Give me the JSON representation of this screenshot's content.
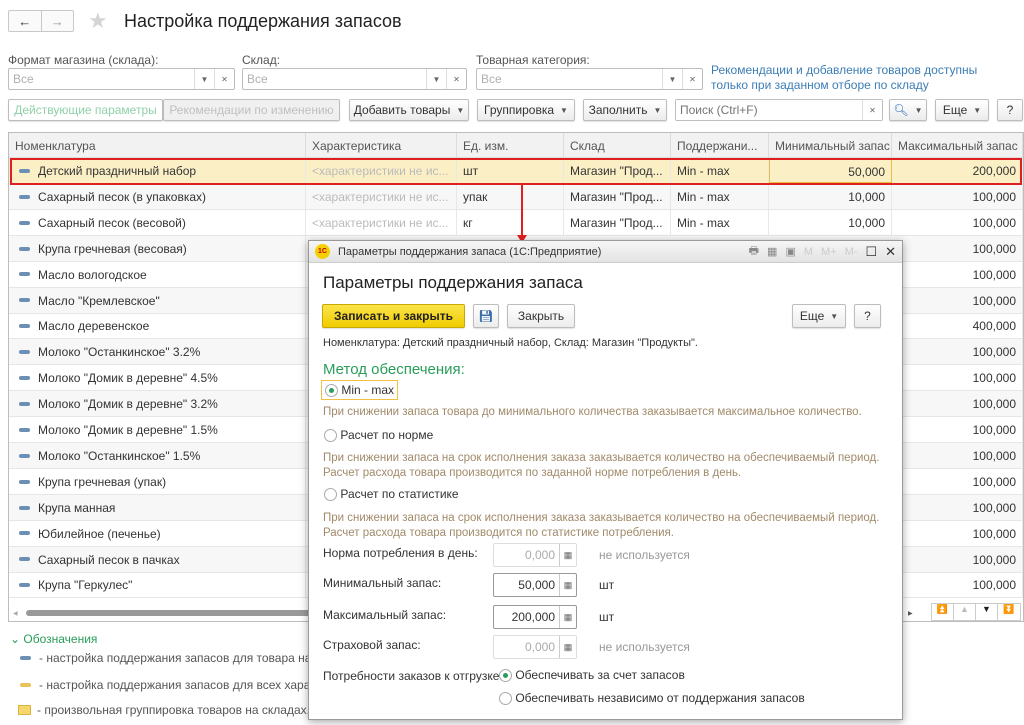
{
  "header": {
    "title": "Настройка поддержания запасов",
    "back_icon": "←",
    "forward_icon": "→"
  },
  "filters": {
    "format_label": "Формат магазина (склада):",
    "format_value": "Все",
    "warehouse_label": "Склад:",
    "warehouse_value": "Все",
    "category_label": "Товарная категория:",
    "category_value": "Все",
    "note": "Рекомендации и добавление товаров доступны только при заданном отборе по складу"
  },
  "toolbar": {
    "tab_current": "Действующие параметры",
    "tab_recommend": "Рекомендации по изменению",
    "add_goods": "Добавить товары",
    "grouping": "Группировка",
    "fill": "Заполнить",
    "search_placeholder": "Поиск (Ctrl+F)",
    "more": "Еще",
    "help": "?"
  },
  "table": {
    "columns": [
      "Номенклатура",
      "Характеристика",
      "Ед. изм.",
      "Склад",
      "Поддержани...",
      "Минимальный запас",
      "Максимальный запас"
    ],
    "rows": [
      {
        "name": "Детский праздничный набор",
        "char": "<характеристики не ис...",
        "unit": "шт",
        "wh": "Магазин \"Прод...",
        "method": "Min - max",
        "min": "50,000",
        "max": "200,000"
      },
      {
        "name": "Сахарный песок (в упаковках)",
        "char": "<характеристики не ис...",
        "unit": "упак",
        "wh": "Магазин \"Прод...",
        "method": "Min - max",
        "min": "10,000",
        "max": "100,000"
      },
      {
        "name": "Сахарный песок (весовой)",
        "char": "<характеристики не ис...",
        "unit": "кг",
        "wh": "Магазин \"Прод...",
        "method": "Min - max",
        "min": "10,000",
        "max": "100,000"
      },
      {
        "name": "Крупа гречневая (весовая)",
        "max": "100,000"
      },
      {
        "name": "Масло вологодское",
        "max": "100,000"
      },
      {
        "name": "Масло \"Кремлевское\"",
        "max": "100,000"
      },
      {
        "name": "Масло деревенское",
        "max": "400,000"
      },
      {
        "name": "Молоко \"Останкинское\" 3.2%",
        "max": "100,000"
      },
      {
        "name": "Молоко \"Домик в деревне\" 4.5%",
        "max": "100,000"
      },
      {
        "name": "Молоко \"Домик в деревне\" 3.2%",
        "max": "100,000"
      },
      {
        "name": "Молоко \"Домик в деревне\" 1.5%",
        "max": "100,000"
      },
      {
        "name": "Молоко \"Останкинское\" 1.5%",
        "max": "100,000"
      },
      {
        "name": "Крупа гречневая (упак)",
        "max": "100,000"
      },
      {
        "name": "Крупа манная",
        "max": "100,000"
      },
      {
        "name": "Юбилейное (печенье)",
        "max": "100,000"
      },
      {
        "name": "Сахарный песок в пачках",
        "max": "100,000"
      },
      {
        "name": "Крупа \"Геркулес\"",
        "max": "100,000"
      }
    ]
  },
  "legend": {
    "title": "Обозначения",
    "items": [
      "- настройка поддержания запасов для товара на с",
      "- настройка поддержания запасов для всех харак",
      "- произвольная группировка товаров на складах,"
    ]
  },
  "dialog": {
    "window_title": "Параметры поддержания запаса  (1С:Предприятие)",
    "title": "Параметры поддержания запаса",
    "save_close": "Записать и закрыть",
    "close": "Закрыть",
    "more": "Еще",
    "help": "?",
    "info": "Номенклатура: Детский праздничный набор, Склад: Магазин \"Продукты\".",
    "method_title": "Метод обеспечения:",
    "options": [
      {
        "label": "Min - max",
        "desc": "При снижении запаса товара до минимального количества заказывается максимальное количество.",
        "selected": true
      },
      {
        "label": "Расчет по норме",
        "desc": "При снижении запаса на срок исполнения заказа заказывается количество на обеспечиваемый период. Расчет расхода товара производится по заданной норме потребления в день.",
        "selected": false
      },
      {
        "label": "Расчет по статистике",
        "desc": "При снижении запаса на срок исполнения заказа заказывается количество на обеспечиваемый период. Расчет расхода товара производится по статистике потребления.",
        "selected": false
      }
    ],
    "fields": [
      {
        "label": "Норма потребления в день:",
        "value": "0,000",
        "unit": "не используется",
        "enabled": false
      },
      {
        "label": "Минимальный запас:",
        "value": "50,000",
        "unit": "шт",
        "enabled": true
      },
      {
        "label": "Максимальный запас:",
        "value": "200,000",
        "unit": "шт",
        "enabled": true
      },
      {
        "label": "Страховой запас:",
        "value": "0,000",
        "unit": "не используется",
        "enabled": false
      }
    ],
    "needs_label": "Потребности заказов к отгрузке:",
    "needs_options": [
      {
        "label": "Обеспечивать за счет запасов",
        "selected": true
      },
      {
        "label": "Обеспечивать независимо от поддержания запасов",
        "selected": false
      }
    ],
    "tb_icons": [
      "M",
      "M+",
      "M-"
    ]
  },
  "colors": {
    "accent_green": "#2a9d5a",
    "highlight": "#e02020",
    "selected_row": "#fbefc6",
    "primary_button": "#f5d000"
  }
}
